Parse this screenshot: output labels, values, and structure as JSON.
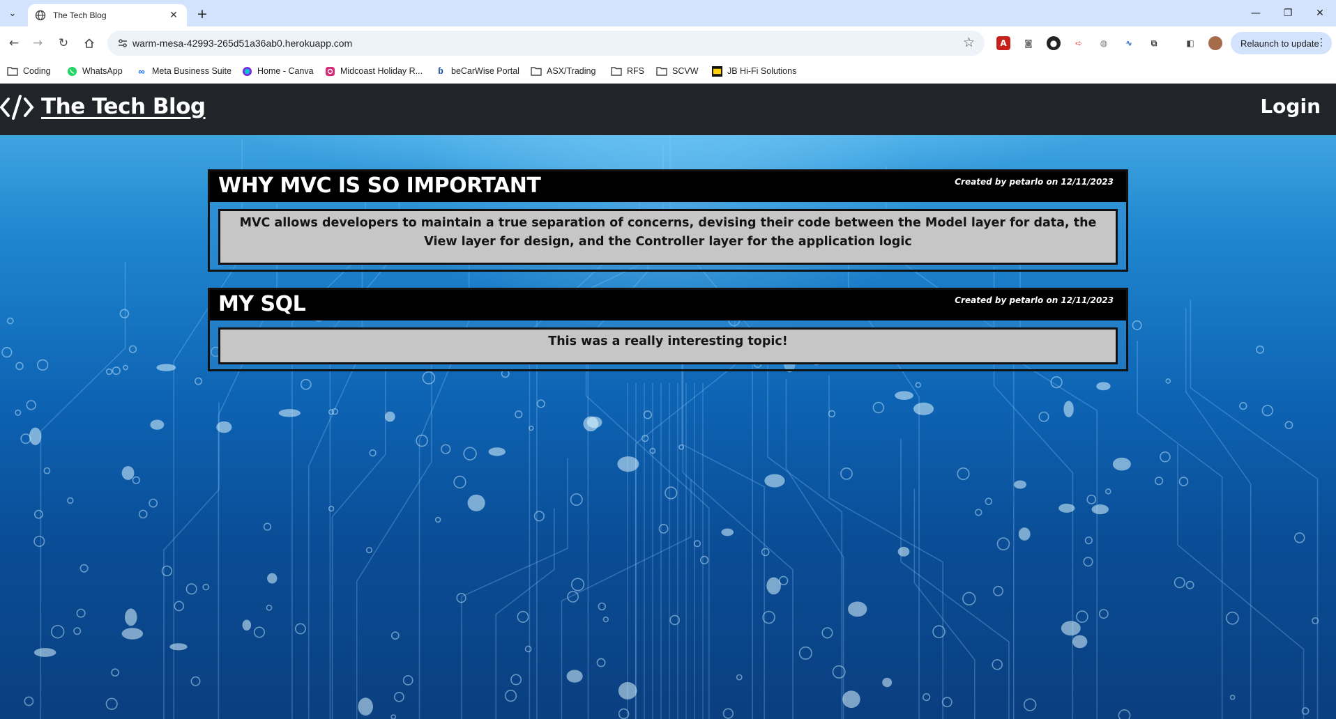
{
  "browser": {
    "tab_title": "The Tech Blog",
    "url": "warm-mesa-42993-265d51a36ab0.herokuapp.com",
    "relaunch_label": "Relaunch to update",
    "bookmarks": [
      "Coding",
      "WhatsApp",
      "Meta Business Suite",
      "Home - Canva",
      "Midcoast Holiday R...",
      "beCarWise Portal",
      "ASX/Trading",
      "RFS",
      "SCVW",
      "JB Hi-Fi Solutions"
    ]
  },
  "site": {
    "title": "The Tech Blog",
    "login_label": "Login"
  },
  "posts": [
    {
      "title": "WHY MVC IS SO IMPORTANT",
      "meta": "Created by petarlo on 12/11/2023",
      "body": "MVC allows developers to maintain a true separation of concerns, devising their code between the Model layer for data, the View layer for design, and the Controller layer for the application logic"
    },
    {
      "title": "MY SQL",
      "meta": "Created by petarlo on 12/11/2023",
      "body": "This was a really interesting topic!"
    }
  ]
}
